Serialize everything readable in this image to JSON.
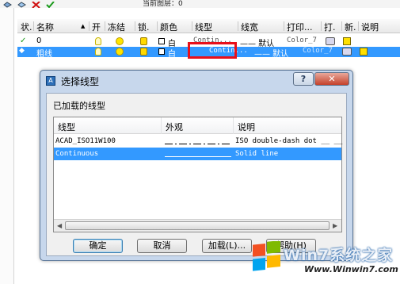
{
  "layer_manager": {
    "current_layer": "当前图层：0",
    "columns": [
      "状.",
      "名称",
      "开",
      "冻结",
      "锁.",
      "颜色",
      "线型",
      "线宽",
      "打印...",
      "打.",
      "新.",
      "说明"
    ],
    "rows": [
      {
        "status": "✓",
        "name": "0",
        "color": "白",
        "linetype": "Contin...",
        "lineweight": "—— 默认",
        "plotstyle": "Color_7",
        "selected": false
      },
      {
        "status": "",
        "name": "粗线",
        "color": "白",
        "linetype": "Contin...",
        "lineweight": "—— 默认",
        "plotstyle": "Color_7",
        "selected": true
      }
    ]
  },
  "dialog": {
    "title": "选择线型",
    "help_button": "?",
    "close_button": "✕",
    "loaded_label": "已加载的线型",
    "columns": {
      "linetype": "线型",
      "appearance": "外观",
      "description": "说明"
    },
    "rows": [
      {
        "linetype": "ACAD_ISO11W100",
        "description": "ISO double-dash dot __ __",
        "selected": false
      },
      {
        "linetype": "Continuous",
        "description": "Solid line",
        "selected": true
      }
    ],
    "buttons": {
      "ok": "确定",
      "cancel": "取消",
      "load": "加载(L)...",
      "help": "帮助(H)"
    }
  },
  "watermark": {
    "brand": "Win7系统之家",
    "url": "Www.Winwin7.com"
  },
  "colors": {
    "selection": "#3399ff",
    "highlight_box": "#e8101a",
    "dialog_frame": "#c7d7ec"
  }
}
